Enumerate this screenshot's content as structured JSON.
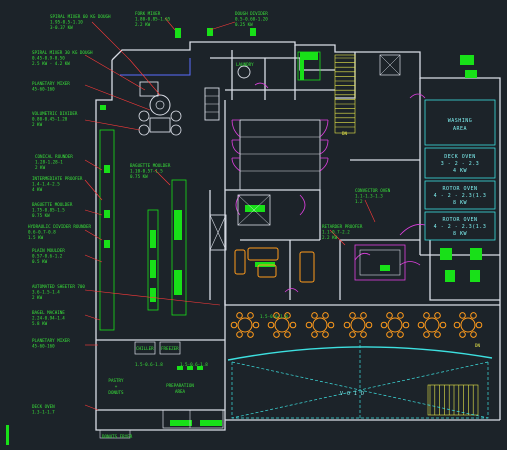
{
  "labels": {
    "spiral_mixer_60": [
      "SPIRAL MIXER 60 KG DOUGH",
      "1.95-0.5-1.10",
      "3-0.37 KW"
    ],
    "fork_mixer": [
      "FORK MIXER",
      "1.80-0.85-1.65",
      "2.2 KW"
    ],
    "dough_divider": [
      "DOUGH DIVIDER",
      "0.5-0.60-1.20",
      "0.25 KW"
    ],
    "spiral_mixer_30": [
      "SPIRAL MIXER 30 KG DOUGH",
      "0.45-0.9-0.50",
      "2.5 KW - 4.2 KW"
    ],
    "planetary_mixer_top": [
      "PLANETARY MIXER",
      "45-60-160"
    ],
    "volumetric_divider": [
      "VOLUMETRIC DIVIDER",
      "0.80-0.45-1.20",
      "2 KW"
    ],
    "conical_rounder": [
      "CONICAL ROUNDER",
      "1.28-1.28-1",
      "2 KW"
    ],
    "intermediate_proofer": [
      "INTERMEDIATE PROOFER",
      "1.4-1.4-2.5",
      "4 KW"
    ],
    "baguette_moulder_left": [
      "BAGUETTE MOULDER",
      "1.75-0.85-1.5",
      "0.75 KW"
    ],
    "hydraulic_divider": [
      "HYDRAULIC DIVIDER ROUNDER",
      "0.6-0.7-0.8",
      "1.5 KW"
    ],
    "plain_moulder": [
      "PLAIN MOULDER",
      "0.57-0.6-1.2",
      "0.5 KW"
    ],
    "baguette_moulder_mid": [
      "BAGUETTE MOULDER",
      "1.10-0.57-1.5",
      "0.75 KW"
    ],
    "automated_sheeter": [
      "AUTOMATED SHEETER 700",
      "3.6-1.5-1.4",
      "2 KW"
    ],
    "bagel_machine": [
      "BAGEL MACHINE",
      "2.24-0.94-1.4",
      "5.8 KW"
    ],
    "planetary_mixer_bottom": [
      "PLANETARY MIXER",
      "45-60-160"
    ],
    "deck_oven_small": [
      "DECK OVEN",
      "1.3-1-1.7"
    ],
    "donuts_fryer": "DONUTS FRYER",
    "convector_oven": [
      "CONVECTOR OVEN",
      "1.1-1.3-1.3",
      "1.2"
    ],
    "retarder_proofer": [
      "RETARDER PROOFER",
      "1.1-0.7-2.2",
      "2.2 KW"
    ],
    "chiller": "CHILLER",
    "freezer": "FREEZER",
    "pastry_area": [
      "PASTRY",
      "+",
      "DONUTS"
    ],
    "preparation_area": [
      "PREPARATION",
      "AREA"
    ],
    "dim_a": "1.5-0.6-1.8",
    "dim_b": "1.5-0.6-1.8",
    "dim_c": "1.5-0.6-1.8"
  },
  "right_panel": {
    "washing": [
      "WASHING",
      "AREA"
    ],
    "deck_oven": [
      "DECK OVEN",
      "3 - 2 - 2.3",
      "4 KW"
    ],
    "rotor_oven_1": [
      "ROTOR OVEN",
      "4 - 2 - 2.3(1.3",
      "8 KW"
    ],
    "rotor_oven_2": [
      "ROTOR OVEN",
      "4 - 2 - 2.3(1.3",
      "8 KW"
    ]
  },
  "void_label": "V O I D",
  "stairs_label_top": "DN",
  "stairs_label_bottom": "DN",
  "laundry_label": "LAUNDRY",
  "colors": {
    "background": "#1c2329",
    "wall": "#d9dde6",
    "equipment": "#18e018",
    "cyan": "#3de0e0",
    "magenta": "#e040e0",
    "yellow": "#e8e84a",
    "orange": "#ff9b1c"
  }
}
